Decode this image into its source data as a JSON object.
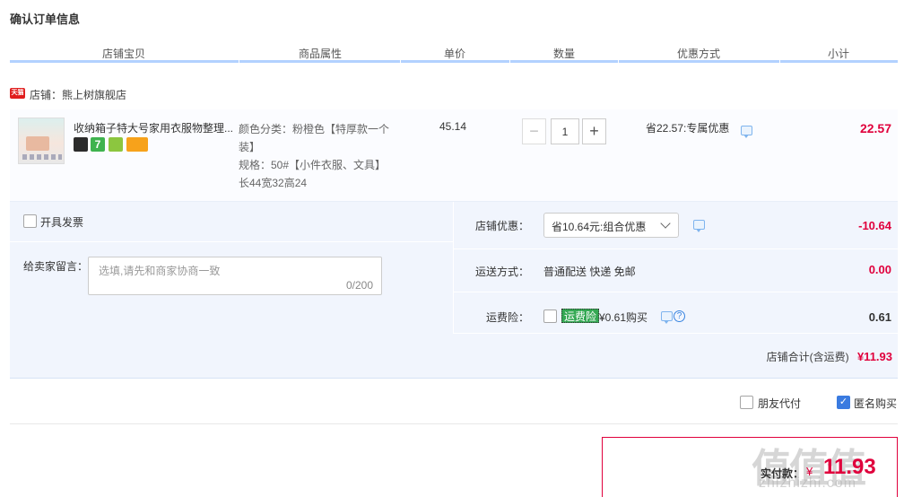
{
  "page": {
    "title": "确认订单信息"
  },
  "columns": [
    "店铺宝贝",
    "商品属性",
    "单价",
    "数量",
    "优惠方式",
    "小计"
  ],
  "shop": {
    "tag": "天猫",
    "label": "店铺：熊上树旗舰店"
  },
  "item": {
    "name": "收纳箱子特大号家用衣服物整理...",
    "attr_lines": [
      "颜色分类：粉橙色【特厚款一个",
      "装】",
      "规格：50#【小件衣服、文具】",
      "长44宽32高24"
    ],
    "price": "45.14",
    "quantity": "1",
    "promo": "省22.57:专属优惠",
    "subtotal": "22.57"
  },
  "invoice": {
    "label": "开具发票"
  },
  "message": {
    "label": "给卖家留言：",
    "placeholder": "选填,请先和商家协商一致",
    "count": "0/200"
  },
  "shop_discount": {
    "label": "店铺优惠：",
    "selected": "省10.64元:组合优惠",
    "amount": "-10.64"
  },
  "shipping": {
    "label": "运送方式：",
    "value": "普通配送 快递 免邮",
    "amount": "0.00"
  },
  "insurance": {
    "label": "运费险：",
    "tag": "运费险",
    "value": "¥0.61购买",
    "amount": "0.61"
  },
  "shop_total": {
    "label": "店铺合计(含运费)",
    "amount": "¥11.93"
  },
  "options": {
    "friend_pay": "朋友代付",
    "anonymous": "匿名购买",
    "anonymous_checked": true,
    "friend_checked": false
  },
  "payment": {
    "label": "实付款：",
    "symbol": "¥",
    "amount": "11.93"
  },
  "watermark": {
    "text": "值值值",
    "sub": "zhizhizhi.com"
  },
  "colors": {
    "accent_red": "#e0003c",
    "header_rule": "#b2d1ff",
    "panel_bg": "#f1f5fd",
    "checkbox_blue": "#3a7be0"
  }
}
